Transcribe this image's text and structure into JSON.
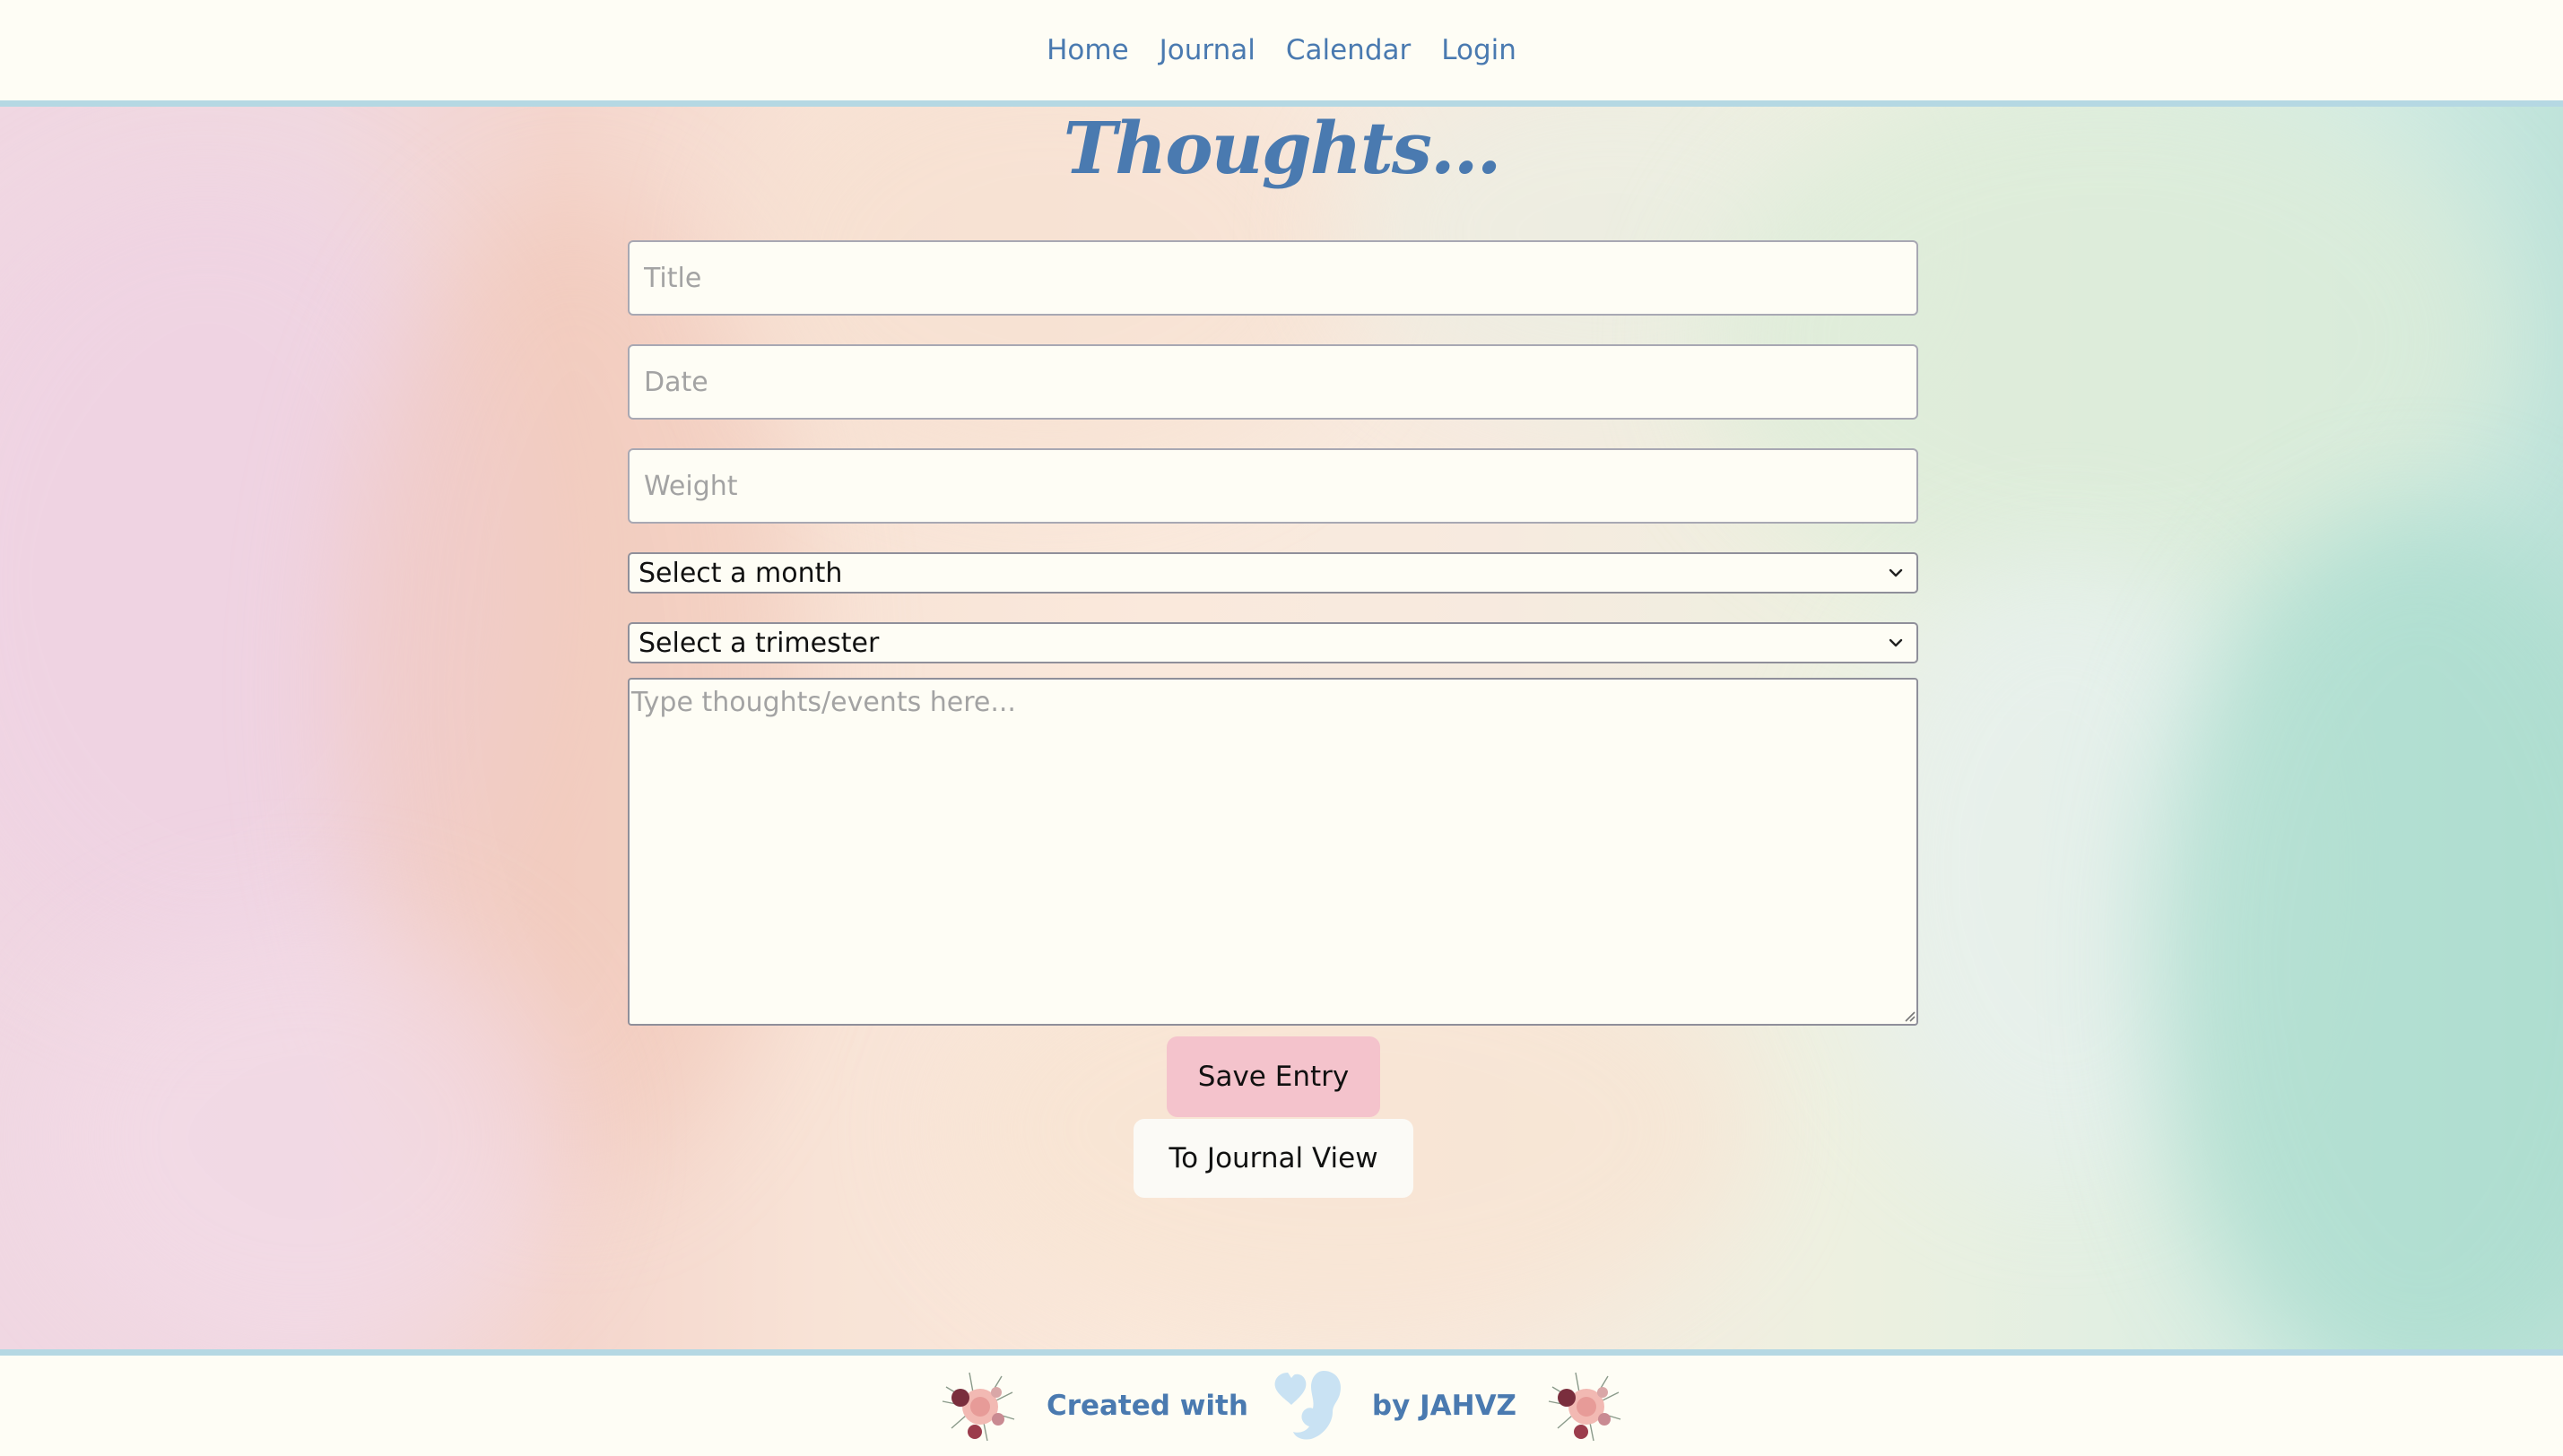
{
  "nav": {
    "links": [
      "Home",
      "Journal",
      "Calendar",
      "Login"
    ]
  },
  "page": {
    "title": "Thoughts..."
  },
  "form": {
    "title_placeholder": "Title",
    "date_placeholder": "Date",
    "weight_placeholder": "Weight",
    "month_select": "Select a month",
    "trimester_select": "Select a trimester",
    "thoughts_placeholder": "Type thoughts/events here..."
  },
  "buttons": {
    "save": "Save Entry",
    "journal_view": "To Journal View"
  },
  "footer": {
    "created_with": "Created with",
    "by": "by JAHVZ",
    "heart_icon": "baby-heart-icon",
    "flower_icon": "flower-bouquet-icon"
  },
  "colors": {
    "accent": "#4a7ab0",
    "divider": "#b5d8e3",
    "save_button": "#f4c3cc",
    "page_bg": "#fefdf5"
  }
}
